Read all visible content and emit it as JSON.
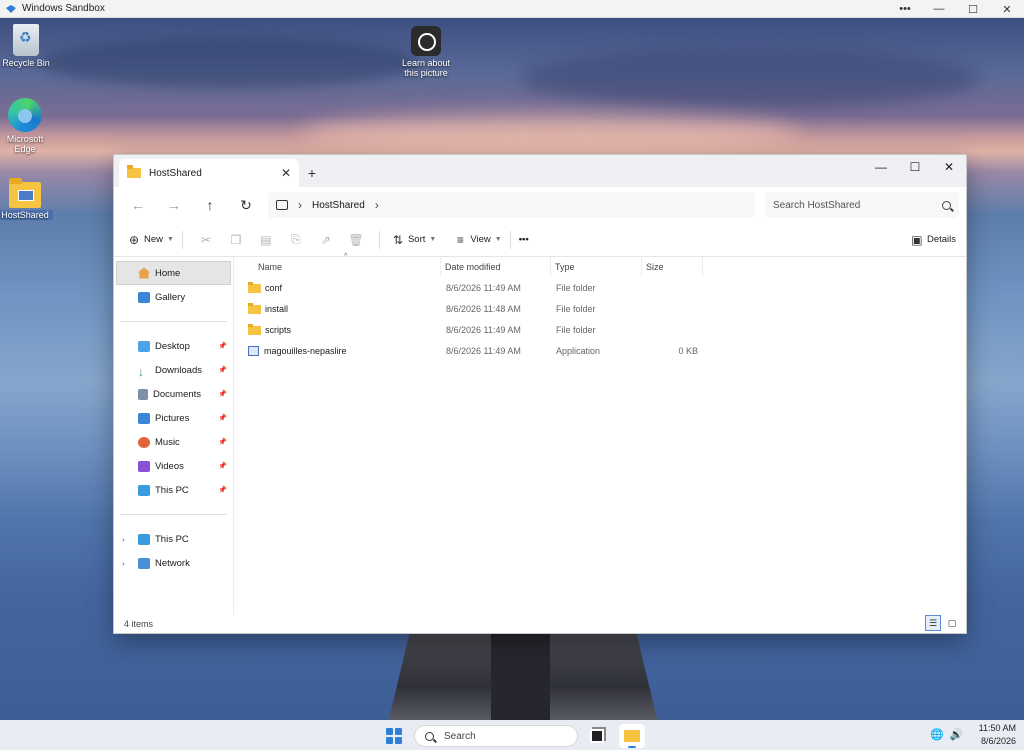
{
  "sandbox": {
    "title": "Windows Sandbox",
    "controls": {
      "more": "•••",
      "minimize": "—",
      "maximize": "☐",
      "close": "✕"
    }
  },
  "desktop": {
    "icons": [
      {
        "label": "Recycle Bin",
        "icon": "recycle-bin-icon"
      },
      {
        "label": "Microsoft Edge",
        "icon": "edge-icon"
      },
      {
        "label": "HostShared",
        "icon": "folder-icon"
      }
    ],
    "learn_label": "Learn about this picture"
  },
  "explorer": {
    "tab_title": "HostShared",
    "tab_close": "✕",
    "new_tab": "+",
    "window_controls": {
      "minimize": "—",
      "maximize": "☐",
      "close": "✕"
    },
    "nav": {
      "back": "←",
      "forward": "→",
      "up": "↑",
      "refresh": "↻"
    },
    "breadcrumb": [
      "HostShared"
    ],
    "search_placeholder": "Search HostShared",
    "toolbar": {
      "new": "New",
      "sort": "Sort",
      "view": "View",
      "more": "•••",
      "details": "Details"
    },
    "sidebar": {
      "top": [
        {
          "label": "Home"
        },
        {
          "label": "Gallery"
        }
      ],
      "pinned": [
        {
          "label": "Desktop",
          "color": "#4aa3e8"
        },
        {
          "label": "Downloads",
          "color": "#2e9e5b"
        },
        {
          "label": "Documents",
          "color": "#7f8fa6"
        },
        {
          "label": "Pictures",
          "color": "#3b86d6"
        },
        {
          "label": "Music",
          "color": "#e0653a"
        },
        {
          "label": "Videos",
          "color": "#8b4fd6"
        },
        {
          "label": "This PC",
          "color": "#3b9be0"
        }
      ],
      "tree": [
        {
          "label": "This PC"
        },
        {
          "label": "Network"
        }
      ]
    },
    "columns": {
      "name": "Name",
      "date": "Date modified",
      "type": "Type",
      "size": "Size"
    },
    "files": [
      {
        "name": "conf",
        "date": "8/6/2026 11:49 AM",
        "type": "File folder",
        "size": "",
        "kind": "folder"
      },
      {
        "name": "install",
        "date": "8/6/2026 11:48 AM",
        "type": "File folder",
        "size": "",
        "kind": "folder"
      },
      {
        "name": "scripts",
        "date": "8/6/2026 11:49 AM",
        "type": "File folder",
        "size": "",
        "kind": "folder"
      },
      {
        "name": "magouilles-nepaslire",
        "date": "8/6/2026 11:49 AM",
        "type": "Application",
        "size": "0 KB",
        "kind": "app"
      }
    ],
    "status": "4 items"
  },
  "taskbar": {
    "search": "Search",
    "time": "11:50 AM",
    "date": "8/6/2026"
  }
}
